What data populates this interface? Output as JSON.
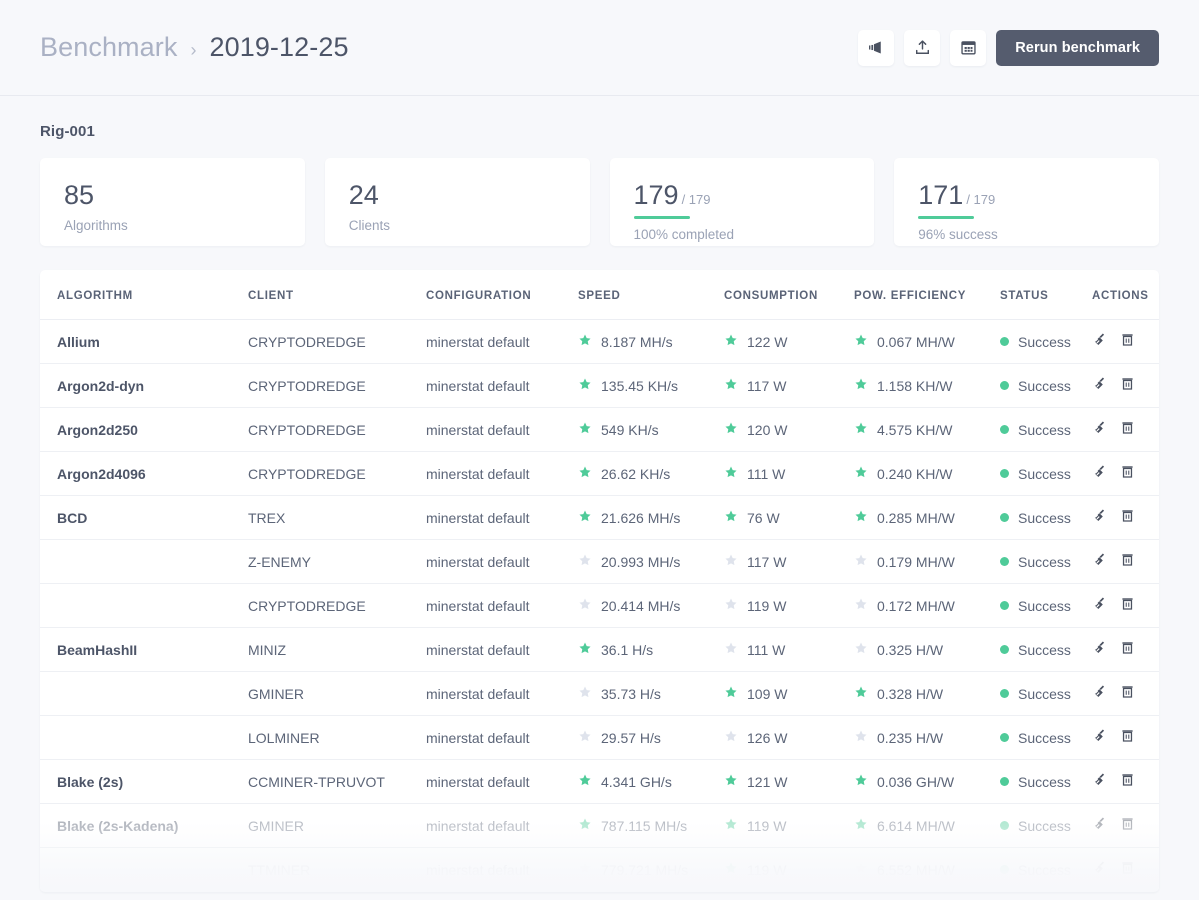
{
  "header": {
    "breadcrumb_root": "Benchmark",
    "breadcrumb_separator": "›",
    "breadcrumb_current": "2019-12-25",
    "actions": {
      "announce_label": "announce",
      "upload_label": "upload",
      "calendar_label": "calendar",
      "rerun_label": "Rerun benchmark"
    }
  },
  "rig": {
    "title": "Rig-001"
  },
  "stats": [
    {
      "value": "85",
      "total": "",
      "label": "Algorithms",
      "sub": "",
      "has_bar": false
    },
    {
      "value": "24",
      "total": "",
      "label": "Clients",
      "sub": "",
      "has_bar": false
    },
    {
      "value": "179",
      "total": "/ 179",
      "label": "",
      "sub": "100% completed",
      "has_bar": true
    },
    {
      "value": "171",
      "total": "/ 179",
      "label": "",
      "sub": "96% success",
      "has_bar": true
    }
  ],
  "table": {
    "columns": [
      "ALGORITHM",
      "CLIENT",
      "CONFIGURATION",
      "SPEED",
      "CONSUMPTION",
      "POW. EFFICIENCY",
      "STATUS",
      "ACTIONS"
    ],
    "status_label": "Success",
    "rows": [
      {
        "algorithm": "Allium",
        "client": "CRYPTODREDGE",
        "configuration": "minerstat default",
        "speed": "8.187 MH/s",
        "speed_best": true,
        "consumption": "122 W",
        "consumption_best": true,
        "efficiency": "0.067 MH/W",
        "efficiency_best": true,
        "status": "Success",
        "fade": 0
      },
      {
        "algorithm": "Argon2d-dyn",
        "client": "CRYPTODREDGE",
        "configuration": "minerstat default",
        "speed": "135.45 KH/s",
        "speed_best": true,
        "consumption": "117 W",
        "consumption_best": true,
        "efficiency": "1.158 KH/W",
        "efficiency_best": true,
        "status": "Success",
        "fade": 0
      },
      {
        "algorithm": "Argon2d250",
        "client": "CRYPTODREDGE",
        "configuration": "minerstat default",
        "speed": "549 KH/s",
        "speed_best": true,
        "consumption": "120 W",
        "consumption_best": true,
        "efficiency": "4.575 KH/W",
        "efficiency_best": true,
        "status": "Success",
        "fade": 0
      },
      {
        "algorithm": "Argon2d4096",
        "client": "CRYPTODREDGE",
        "configuration": "minerstat default",
        "speed": "26.62 KH/s",
        "speed_best": true,
        "consumption": "111 W",
        "consumption_best": true,
        "efficiency": "0.240 KH/W",
        "efficiency_best": true,
        "status": "Success",
        "fade": 0
      },
      {
        "algorithm": "BCD",
        "client": "TREX",
        "configuration": "minerstat default",
        "speed": "21.626 MH/s",
        "speed_best": true,
        "consumption": "76 W",
        "consumption_best": true,
        "efficiency": "0.285 MH/W",
        "efficiency_best": true,
        "status": "Success",
        "fade": 0
      },
      {
        "algorithm": "",
        "client": "Z-ENEMY",
        "configuration": "minerstat default",
        "speed": "20.993 MH/s",
        "speed_best": false,
        "consumption": "117 W",
        "consumption_best": false,
        "efficiency": "0.179 MH/W",
        "efficiency_best": false,
        "status": "Success",
        "fade": 0
      },
      {
        "algorithm": "",
        "client": "CRYPTODREDGE",
        "configuration": "minerstat default",
        "speed": "20.414 MH/s",
        "speed_best": false,
        "consumption": "119 W",
        "consumption_best": false,
        "efficiency": "0.172 MH/W",
        "efficiency_best": false,
        "status": "Success",
        "fade": 0
      },
      {
        "algorithm": "BeamHashII",
        "client": "MINIZ",
        "configuration": "minerstat default",
        "speed": "36.1 H/s",
        "speed_best": true,
        "consumption": "111 W",
        "consumption_best": false,
        "efficiency": "0.325 H/W",
        "efficiency_best": false,
        "status": "Success",
        "fade": 0
      },
      {
        "algorithm": "",
        "client": "GMINER",
        "configuration": "minerstat default",
        "speed": "35.73 H/s",
        "speed_best": false,
        "consumption": "109 W",
        "consumption_best": true,
        "efficiency": "0.328 H/W",
        "efficiency_best": true,
        "status": "Success",
        "fade": 0
      },
      {
        "algorithm": "",
        "client": "LOLMINER",
        "configuration": "minerstat default",
        "speed": "29.57 H/s",
        "speed_best": false,
        "consumption": "126 W",
        "consumption_best": false,
        "efficiency": "0.235 H/W",
        "efficiency_best": false,
        "status": "Success",
        "fade": 0
      },
      {
        "algorithm": "Blake (2s)",
        "client": "CCMINER-TPRUVOT",
        "configuration": "minerstat default",
        "speed": "4.341 GH/s",
        "speed_best": true,
        "consumption": "121 W",
        "consumption_best": true,
        "efficiency": "0.036 GH/W",
        "efficiency_best": true,
        "status": "Success",
        "fade": 0
      },
      {
        "algorithm": "Blake (2s-Kadena)",
        "client": "GMINER",
        "configuration": "minerstat default",
        "speed": "787.115 MH/s",
        "speed_best": true,
        "consumption": "119 W",
        "consumption_best": true,
        "efficiency": "6.614 MH/W",
        "efficiency_best": true,
        "status": "Success",
        "fade": 1
      },
      {
        "algorithm": "",
        "client": "TTMINER",
        "configuration": "minerstat default",
        "speed": "779.721 MH/s",
        "speed_best": false,
        "consumption": "119 W",
        "consumption_best": true,
        "efficiency": "6.552 MH/W",
        "efficiency_best": false,
        "status": "Success",
        "fade": 2
      }
    ]
  },
  "colors": {
    "page_background": "#f7f8fb",
    "card_background": "#ffffff",
    "accent_green": "#4fcb99",
    "primary_button": "#555c6e",
    "text_dark": "#4d5568",
    "text_muted": "#9aa2b5",
    "star_inactive": "#dfe3ec"
  }
}
